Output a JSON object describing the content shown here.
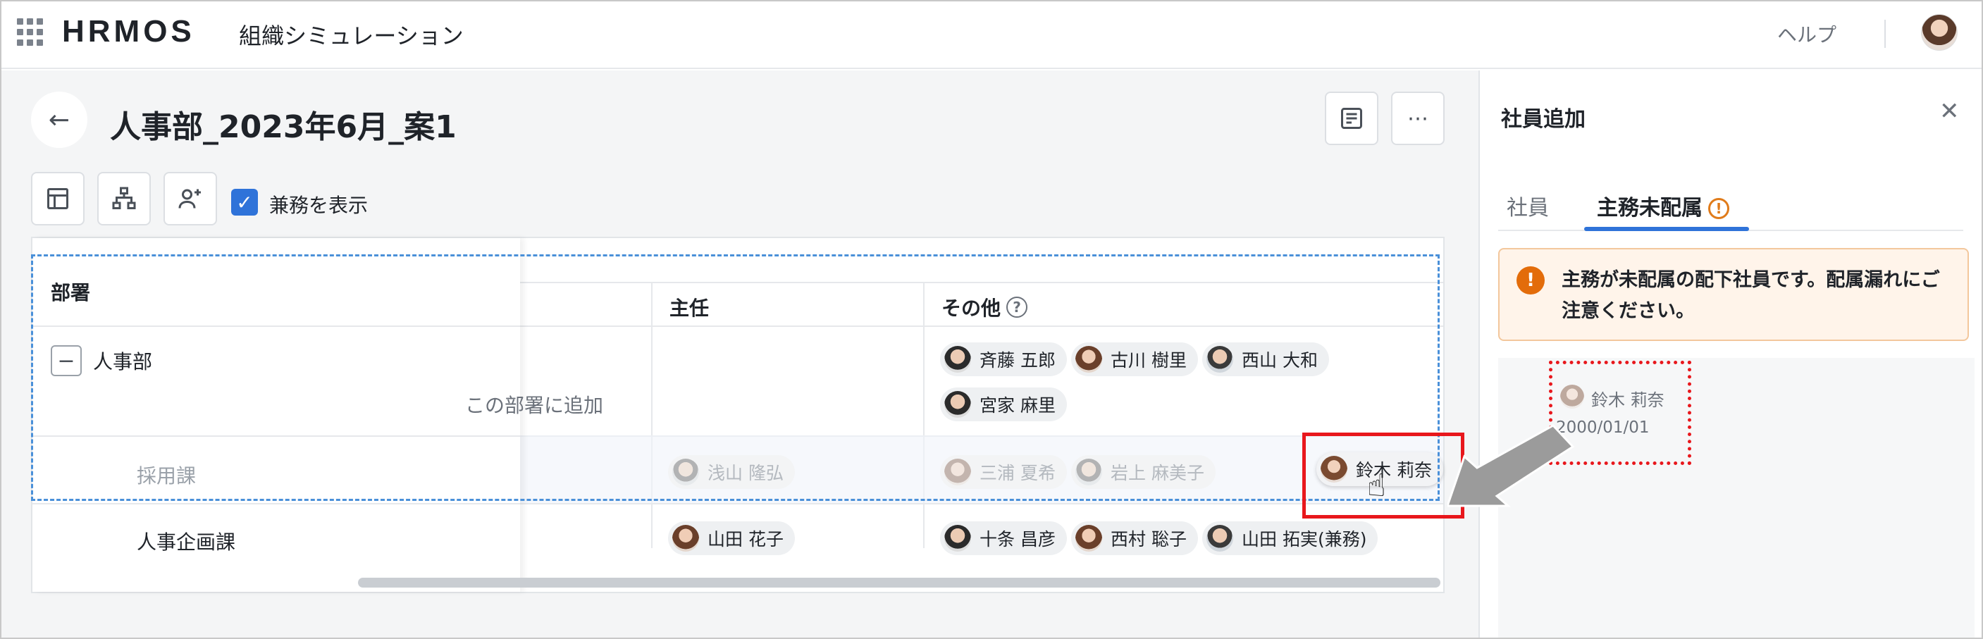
{
  "header": {
    "logo": "HRMOS",
    "app_title": "組織シミュレーション",
    "help": "ヘルプ"
  },
  "page": {
    "title": "人事部_2023年6月_案1",
    "show_concurrent_label": "兼務を表示"
  },
  "table": {
    "headers": {
      "department": "部署",
      "chief": "主任",
      "other": "その他"
    },
    "rows": [
      {
        "dept": "人事部",
        "chief": [],
        "other": [
          "斉藤 五郎",
          "古川 樹里",
          "西山 大和",
          "宮家 麻里"
        ]
      },
      {
        "dept": "採用課",
        "add_hint": "この部署に追加",
        "chief": [
          "浅山 隆弘"
        ],
        "other": [
          "三浦 夏希",
          "岩上 麻美子"
        ],
        "dragging": "鈴木 莉奈"
      },
      {
        "dept": "人事企画課",
        "chief": [
          "山田 花子"
        ],
        "other": [
          "十条 昌彦",
          "西村 聡子",
          "山田 拓実(兼務)"
        ]
      }
    ]
  },
  "panel": {
    "title": "社員追加",
    "tabs": [
      {
        "label": "社員"
      },
      {
        "label": "主務未配属"
      }
    ],
    "alert": "主務が未配属の配下社員です。配属漏れにご注意ください。",
    "employee": {
      "name": "鈴木 莉奈",
      "date": "2000/01/01"
    }
  },
  "colors": {
    "accent": "#2f73d9",
    "warning": "#e36c0a",
    "highlight": "#e8171c"
  }
}
